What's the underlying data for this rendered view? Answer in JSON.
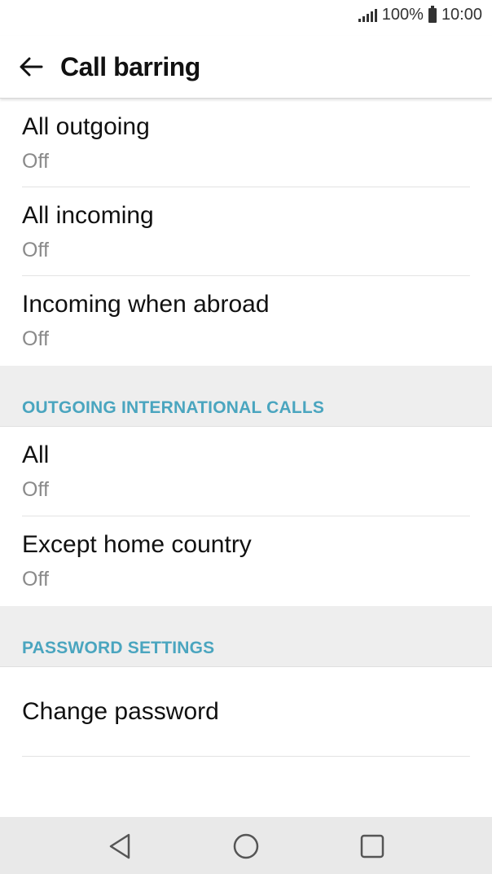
{
  "status_bar": {
    "battery_text": "100%",
    "time": "10:00"
  },
  "header": {
    "title": "Call barring"
  },
  "sections": {
    "main": [
      {
        "title": "All outgoing",
        "summary": "Off"
      },
      {
        "title": "All incoming",
        "summary": "Off"
      },
      {
        "title": "Incoming when abroad",
        "summary": "Off"
      }
    ],
    "intl_header": "OUTGOING INTERNATIONAL CALLS",
    "intl": [
      {
        "title": "All",
        "summary": "Off"
      },
      {
        "title": "Except home country",
        "summary": "Off"
      }
    ],
    "password_header": "PASSWORD SETTINGS",
    "password": [
      {
        "title": "Change password"
      }
    ]
  },
  "colors": {
    "section_header_text": "#4aa5bf",
    "section_header_bg": "#eeeeee",
    "nav_bar_bg": "#e9e9e9"
  },
  "icons": {
    "back": "arrow-left-icon",
    "nav_back": "triangle-back-icon",
    "nav_home": "circle-home-icon",
    "nav_recents": "square-recents-icon"
  }
}
